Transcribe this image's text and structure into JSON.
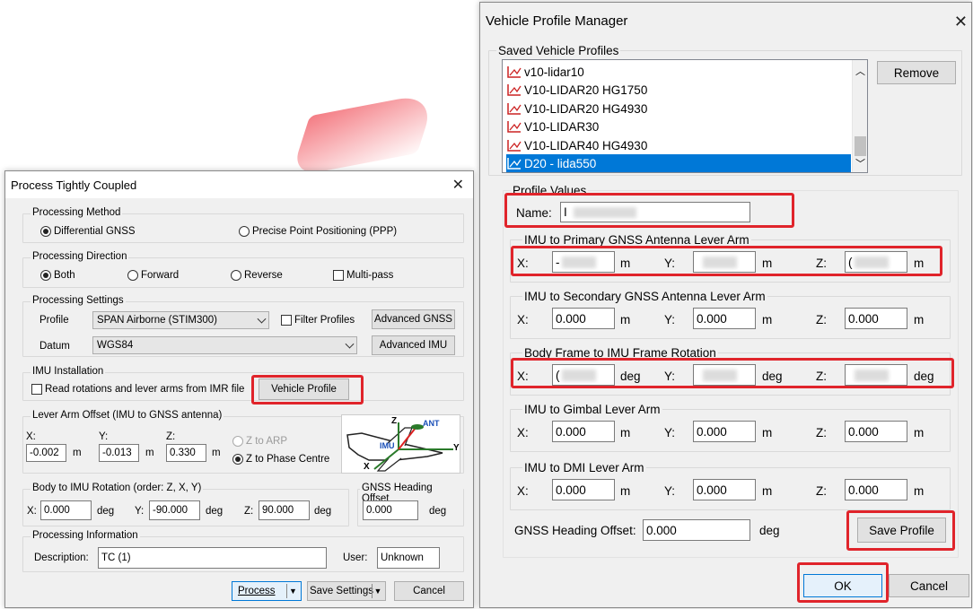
{
  "ptc": {
    "title": "Process Tightly Coupled",
    "proc_method": {
      "label": "Processing Method",
      "differential": "Differential GNSS",
      "ppp": "Precise Point Positioning (PPP)"
    },
    "proc_direction": {
      "label": "Processing Direction",
      "both": "Both",
      "forward": "Forward",
      "reverse": "Reverse",
      "multipass": "Multi-pass"
    },
    "proc_settings": {
      "label": "Processing Settings",
      "profile_label": "Profile",
      "profile_value": "SPAN Airborne (STIM300)",
      "filter_profiles": "Filter Profiles",
      "advanced_gnss": "Advanced GNSS",
      "datum_label": "Datum",
      "datum_value": "WGS84",
      "advanced_imu": "Advanced IMU"
    },
    "imu_install": {
      "label": "IMU Installation",
      "read_rotations": "Read rotations and lever arms from IMR file",
      "vehicle_profile": "Vehicle Profile"
    },
    "lever_arm": {
      "label": "Lever Arm Offset (IMU to GNSS antenna)",
      "x_label": "X:",
      "y_label": "Y:",
      "z_label": "Z:",
      "x": "-0.002",
      "y": "-0.013",
      "z": "0.330",
      "unit": "m",
      "z_to_arp": "Z to ARP",
      "z_to_phase": "Z to Phase Centre",
      "diagram": {
        "z": "Z",
        "ant": "ANT",
        "imu": "IMU",
        "y": "Y",
        "x": "X"
      }
    },
    "body_rotation": {
      "label": "Body to IMU Rotation (order: Z, X, Y)",
      "x_label": "X:",
      "y_label": "Y:",
      "z_label": "Z:",
      "x": "0.000",
      "y": "-90.000",
      "z": "90.000",
      "unit": "deg"
    },
    "gnss_heading": {
      "label": "GNSS Heading Offset",
      "value": "0.000",
      "unit": "deg"
    },
    "proc_info": {
      "label": "Processing Information",
      "desc_label": "Description:",
      "desc_value": "TC (1)",
      "user_label": "User:",
      "user_value": "Unknown"
    },
    "buttons": {
      "process": "Process",
      "save_settings": "Save Settings",
      "cancel": "Cancel"
    }
  },
  "vpm": {
    "title": "Vehicle Profile Manager",
    "saved_label": "Saved Vehicle Profiles",
    "profiles": [
      "v10-lidar10",
      "V10-LIDAR20 HG1750",
      "V10-LIDAR20 HG4930",
      "V10-LIDAR30",
      "V10-LIDAR40 HG4930",
      "D20 - lida550"
    ],
    "selected_index": 5,
    "remove": "Remove",
    "profile_values_label": "Profile Values",
    "name_label": "Name:",
    "name_value": "I",
    "sections": [
      {
        "label": "IMU to Primary GNSS Antenna Lever Arm",
        "x": "-",
        "y": "",
        "z": "(",
        "unit": "m"
      },
      {
        "label": "IMU to Secondary GNSS Antenna Lever Arm",
        "x": "0.000",
        "y": "0.000",
        "z": "0.000",
        "unit": "m"
      },
      {
        "label": "Body Frame to IMU Frame Rotation",
        "x": "(",
        "y": "",
        "z": "",
        "unit": "deg"
      },
      {
        "label": "IMU to Gimbal Lever Arm",
        "x": "0.000",
        "y": "0.000",
        "z": "0.000",
        "unit": "m"
      },
      {
        "label": "IMU to DMI Lever Arm",
        "x": "0.000",
        "y": "0.000",
        "z": "0.000",
        "unit": "m"
      }
    ],
    "axis": {
      "x": "X:",
      "y": "Y:",
      "z": "Z:"
    },
    "gnss_heading_label": "GNSS Heading Offset:",
    "gnss_heading_value": "0.000",
    "gnss_heading_unit": "deg",
    "save_profile": "Save Profile",
    "ok": "OK",
    "cancel": "Cancel"
  },
  "colors": {
    "highlight": "#e0242b",
    "selection": "#0078d7"
  }
}
